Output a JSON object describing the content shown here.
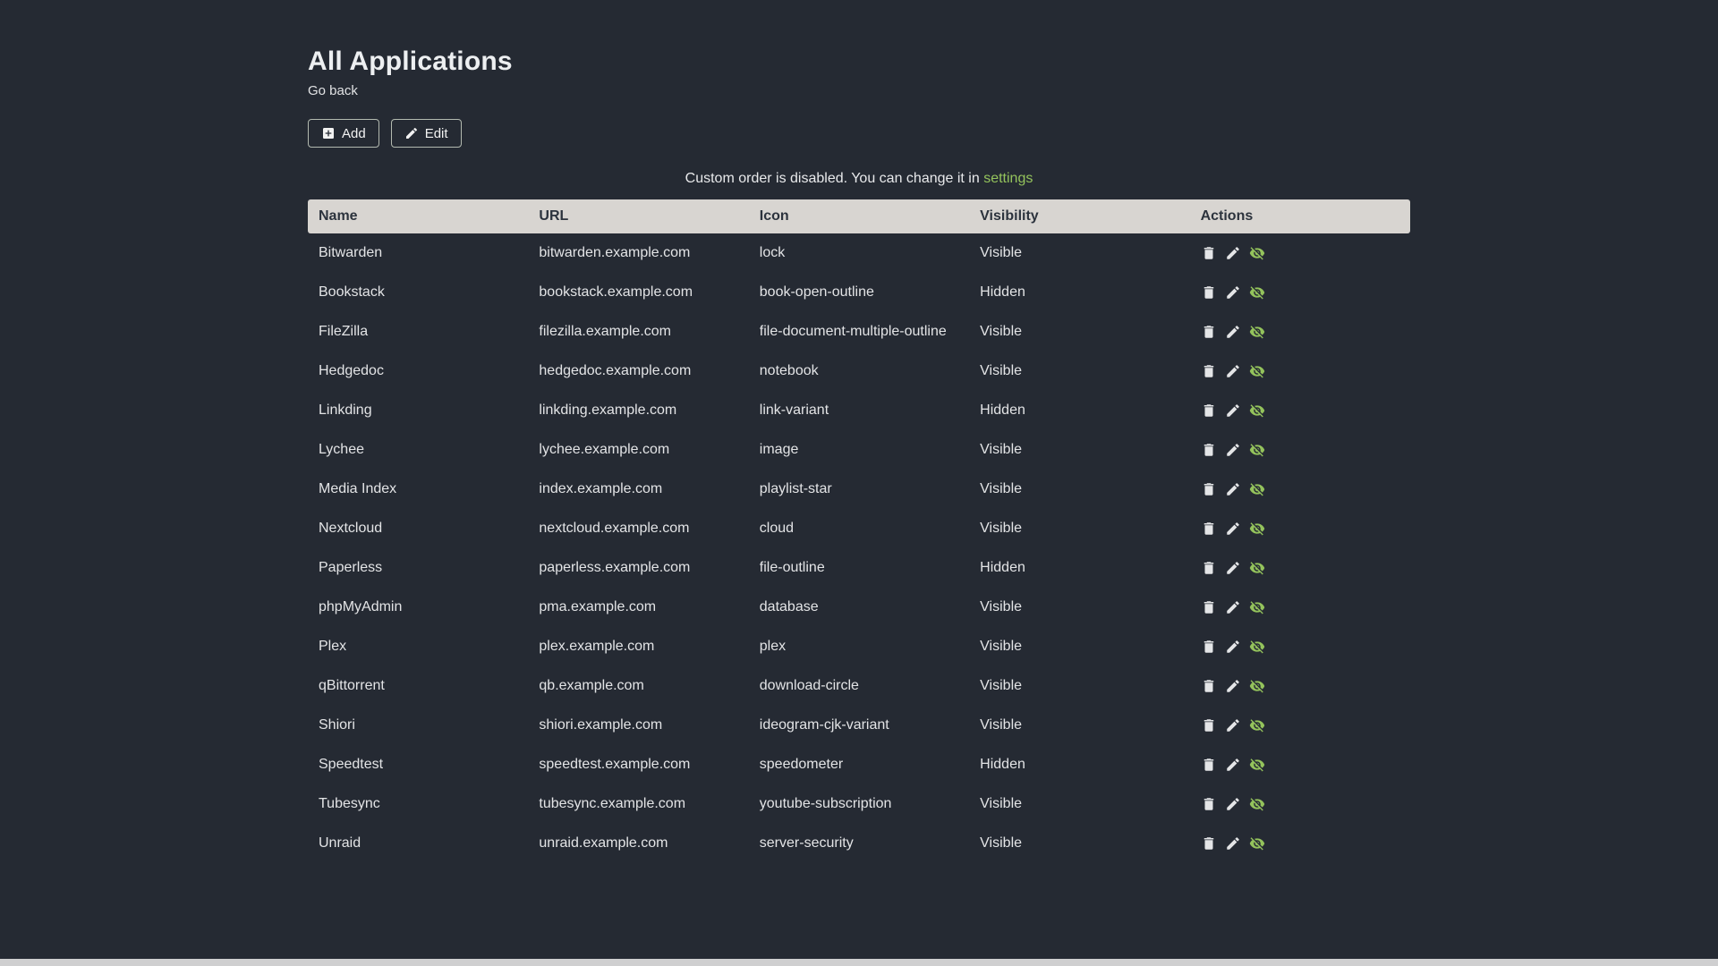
{
  "page": {
    "title": "All Applications",
    "go_back_label": "Go back",
    "info_text": "Custom order is disabled. You can change it in",
    "info_link_label": "settings"
  },
  "toolbar": {
    "add_label": "Add",
    "edit_label": "Edit"
  },
  "table": {
    "headers": [
      "Name",
      "URL",
      "Icon",
      "Visibility",
      "Actions"
    ],
    "rows": [
      {
        "name": "Bitwarden",
        "url": "bitwarden.example.com",
        "icon": "lock",
        "visibility": "Visible"
      },
      {
        "name": "Bookstack",
        "url": "bookstack.example.com",
        "icon": "book-open-outline",
        "visibility": "Hidden"
      },
      {
        "name": "FileZilla",
        "url": "filezilla.example.com",
        "icon": "file-document-multiple-outline",
        "visibility": "Visible"
      },
      {
        "name": "Hedgedoc",
        "url": "hedgedoc.example.com",
        "icon": "notebook",
        "visibility": "Visible"
      },
      {
        "name": "Linkding",
        "url": "linkding.example.com",
        "icon": "link-variant",
        "visibility": "Hidden"
      },
      {
        "name": "Lychee",
        "url": "lychee.example.com",
        "icon": "image",
        "visibility": "Visible"
      },
      {
        "name": "Media Index",
        "url": "index.example.com",
        "icon": "playlist-star",
        "visibility": "Visible"
      },
      {
        "name": "Nextcloud",
        "url": "nextcloud.example.com",
        "icon": "cloud",
        "visibility": "Visible"
      },
      {
        "name": "Paperless",
        "url": "paperless.example.com",
        "icon": "file-outline",
        "visibility": "Hidden"
      },
      {
        "name": "phpMyAdmin",
        "url": "pma.example.com",
        "icon": "database",
        "visibility": "Visible"
      },
      {
        "name": "Plex",
        "url": "plex.example.com",
        "icon": "plex",
        "visibility": "Visible"
      },
      {
        "name": "qBittorrent",
        "url": "qb.example.com",
        "icon": "download-circle",
        "visibility": "Visible"
      },
      {
        "name": "Shiori",
        "url": "shiori.example.com",
        "icon": "ideogram-cjk-variant",
        "visibility": "Visible"
      },
      {
        "name": "Speedtest",
        "url": "speedtest.example.com",
        "icon": "speedometer",
        "visibility": "Hidden"
      },
      {
        "name": "Tubesync",
        "url": "tubesync.example.com",
        "icon": "youtube-subscription",
        "visibility": "Visible"
      },
      {
        "name": "Unraid",
        "url": "unraid.example.com",
        "icon": "server-security",
        "visibility": "Visible"
      }
    ]
  },
  "icons": {
    "add_button": "plus-box-icon",
    "edit_button": "pencil-icon",
    "row_actions": [
      "delete-icon",
      "pencil-icon",
      "eye-off-icon"
    ]
  },
  "colors": {
    "background": "#252a33",
    "accent": "#94c35c",
    "header_bg": "#d8d5d1",
    "header_text": "#2c333d"
  }
}
